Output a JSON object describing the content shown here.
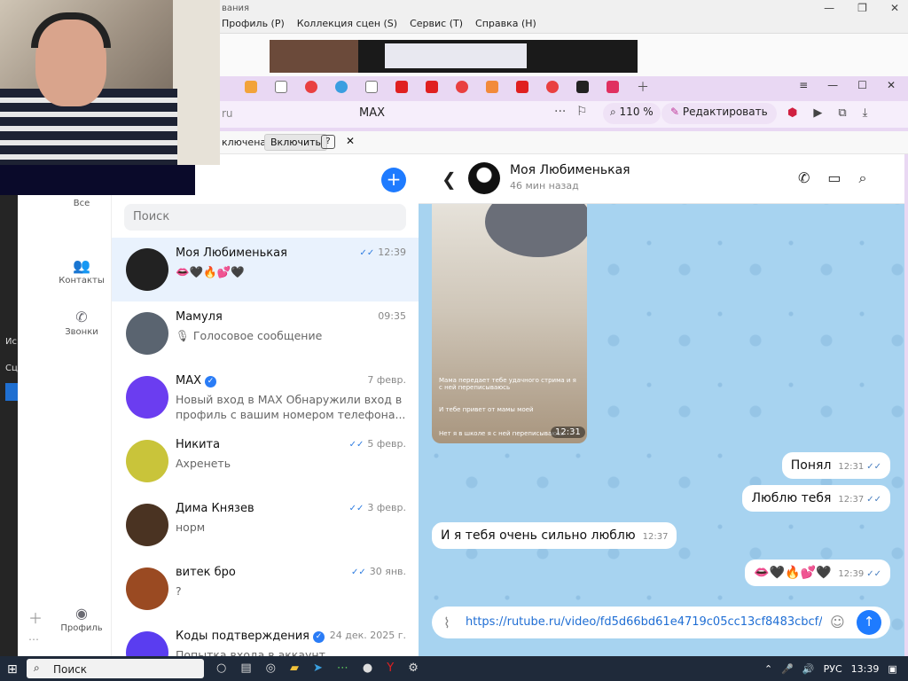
{
  "obs": {
    "title_fragment": "вания",
    "menu": [
      "Профиль (P)",
      "Коллекция сцен (S)",
      "Сервис (T)",
      "Справка (H)"
    ],
    "left_texts": [
      "Ис",
      "Сц",
      "Сц"
    ]
  },
  "browser": {
    "address": "MAX",
    "url_fragment": "ru",
    "zoom": "110 %",
    "edit_label": "Редактировать",
    "info_text": "ключена",
    "info_button": "Включить",
    "info_help": "?",
    "info_close": "✕"
  },
  "rail": {
    "all": "Все",
    "contacts": "Контакты",
    "calls": "Звонки",
    "profile": "Профиль"
  },
  "search_placeholder": "Поиск",
  "chats": [
    {
      "name": "Моя Любименькая",
      "time": "12:39",
      "preview": "👄🖤🔥💕🖤",
      "read": true,
      "active": true,
      "verified": false,
      "color": "#222"
    },
    {
      "name": "Мамуля",
      "time": "09:35",
      "preview": "🎙 Голосовое сообщение",
      "read": false,
      "active": false,
      "verified": false,
      "color": "#5a6470"
    },
    {
      "name": "MAX",
      "time": "7 февр.",
      "preview": "Новый вход в MAX Обнаружили вход в профиль с вашим номером телефона...",
      "read": false,
      "active": false,
      "verified": true,
      "color": "#6b3df0"
    },
    {
      "name": "Никита",
      "time": "5 февр.",
      "preview": "Ахренеть",
      "read": true,
      "active": false,
      "verified": false,
      "color": "#c9c43a"
    },
    {
      "name": "Дима Князев",
      "time": "3 февр.",
      "preview": "норм",
      "read": true,
      "active": false,
      "verified": false,
      "color": "#4a3322"
    },
    {
      "name": "витек бро",
      "time": "30 янв.",
      "preview": "?",
      "read": true,
      "active": false,
      "verified": false,
      "color": "#9a4a22"
    },
    {
      "name": "Коды подтверждения",
      "time": "24 дек. 2025 г.",
      "preview": "Попытка входа в аккаунт",
      "read": false,
      "active": false,
      "verified": true,
      "color": "#5a3df0"
    }
  ],
  "chat": {
    "name": "Моя Любименькая",
    "status": "46 мин назад",
    "media_time": "12:31",
    "media_captions": [
      "Мама передает тебе удачного стрима и я с ней переписываюсь",
      "И тебе привет от мамы моей",
      "Нет я в школе я с ней переписываюсь"
    ],
    "messages": [
      {
        "text": "Понял",
        "time": "12:31",
        "out": true
      },
      {
        "text": "Люблю тебя",
        "time": "12:37",
        "out": true
      },
      {
        "text": "И я тебя очень сильно люблю",
        "time": "12:37",
        "out": false
      },
      {
        "text": "👄🖤🔥💕🖤",
        "time": "12:39",
        "out": true
      }
    ],
    "composer_text": "https://rutube.ru/video/fd5d66bd61e4719c05cc13cf8483cbcf/"
  },
  "taskbar": {
    "search": "Поиск",
    "lang": "РУС",
    "time": "13:39"
  }
}
